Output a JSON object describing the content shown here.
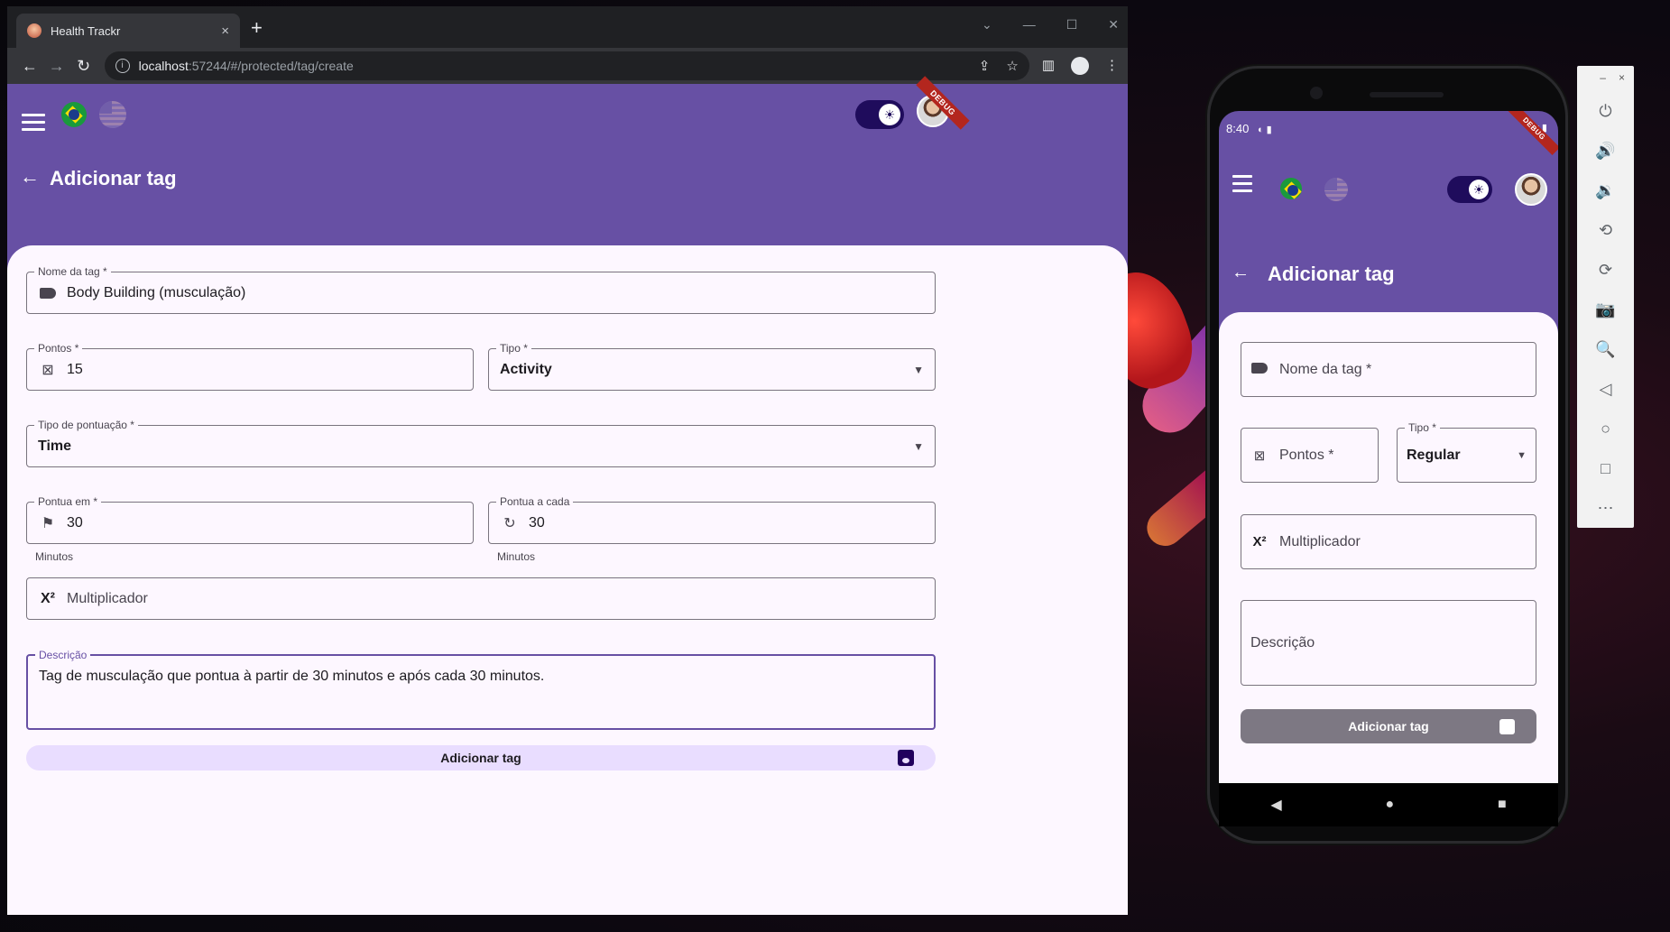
{
  "browser": {
    "tab_title": "Health Trackr",
    "tab_close": "×",
    "new_tab": "+",
    "url_host": "localhost",
    "url_path": ":57244/#/protected/tag/create",
    "window_controls": [
      "⌄",
      "—",
      "☐",
      "✕"
    ]
  },
  "app": {
    "debug_banner": "DEBUG",
    "page_title": "Adicionar tag",
    "theme_toggle": "☀",
    "back": "←"
  },
  "web_form": {
    "tag_name": {
      "label": "Nome da tag *",
      "value": "Body Building (musculação)"
    },
    "points": {
      "label": "Pontos *",
      "value": "15",
      "icon": "⊠"
    },
    "type": {
      "label": "Tipo *",
      "value": "Activity"
    },
    "score_type": {
      "label": "Tipo de pontuação *",
      "value": "Time"
    },
    "score_at": {
      "label": "Pontua em *",
      "value": "30",
      "helper": "Minutos",
      "icon": "⚑"
    },
    "score_every": {
      "label": "Pontua a cada",
      "value": "30",
      "helper": "Minutos",
      "icon": "↻"
    },
    "multiplier": {
      "placeholder": "Multiplicador",
      "icon": "X²"
    },
    "description": {
      "label": "Descrição",
      "value": "Tag de musculação que pontua à partir de 30 minutos e após cada 30 minutos."
    },
    "submit_label": "Adicionar tag"
  },
  "phone": {
    "status_time": "8:40",
    "status_icons": "◐ ▮",
    "status_right": "▾ ▮",
    "form": {
      "tag_name_placeholder": "Nome da tag *",
      "points_placeholder": "Pontos *",
      "type_label": "Tipo *",
      "type_value": "Regular",
      "multiplier_placeholder": "Multiplicador",
      "description_placeholder": "Descrição",
      "submit_label": "Adicionar tag"
    },
    "nav": [
      "◀",
      "●",
      "■"
    ]
  },
  "emulator_panel": {
    "top_controls": [
      "–",
      "×"
    ],
    "buttons": [
      "⏻",
      "🔊",
      "🔉",
      "⟲",
      "⟳",
      "📷",
      "🔍",
      "◁",
      "○",
      "□",
      "⋯"
    ]
  },
  "colors": {
    "primary": "#6750a4",
    "surface": "#fdf7ff",
    "submit_web": "#e9ddff",
    "submit_phone": "#7d7883"
  }
}
